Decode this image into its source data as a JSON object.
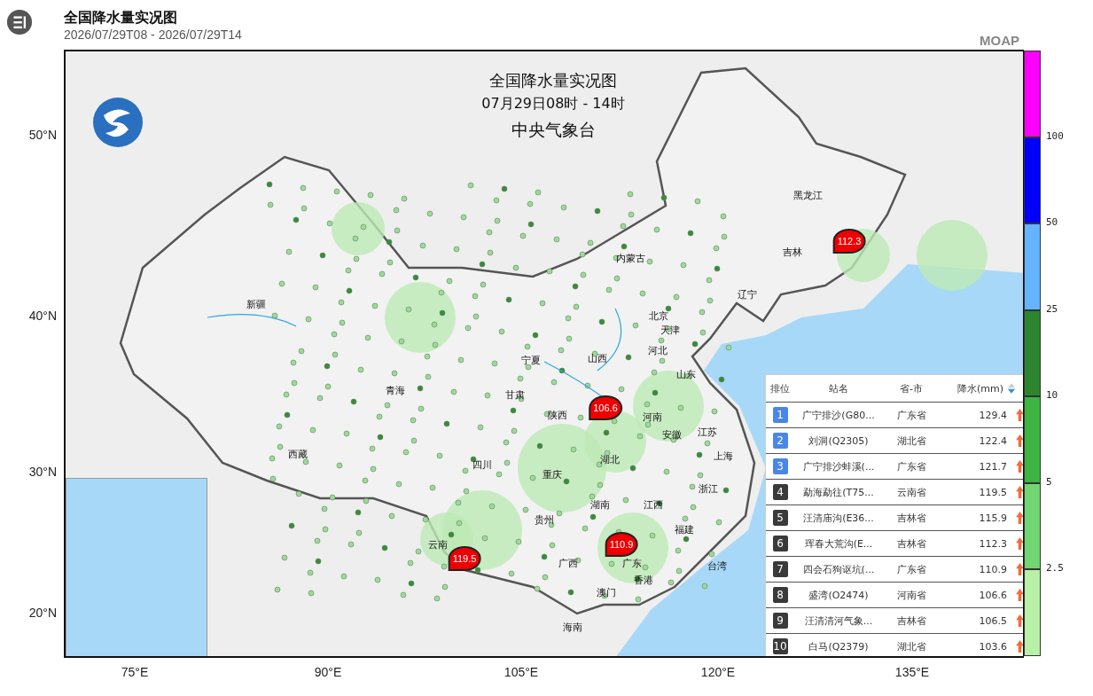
{
  "header": {
    "title": "全国降水量实况图",
    "time_range": "2026/07/29T08  -  2026/07/29T14",
    "product": "MOAP"
  },
  "map": {
    "title_lines": [
      "全国降水量实况图",
      "07月29日08时 - 14时",
      "中央气象台"
    ],
    "lat_ticks": [
      "50°N",
      "40°N",
      "30°N",
      "20°N"
    ],
    "lon_ticks": [
      "75°E",
      "90°E",
      "105°E",
      "120°E",
      "135°E"
    ],
    "region_labels": [
      "新疆",
      "西藏",
      "青海",
      "甘肃",
      "宁夏",
      "内蒙古",
      "黑龙江",
      "吉林",
      "辽宁",
      "北京",
      "天津",
      "河北",
      "山西",
      "山东",
      "河南",
      "陕西",
      "四川",
      "重庆",
      "湖北",
      "安徽",
      "江苏",
      "上海",
      "浙江",
      "湖南",
      "江西",
      "贵州",
      "云南",
      "广西",
      "广东",
      "福建",
      "台湾",
      "香港",
      "澳门",
      "海南"
    ],
    "markers": [
      "119.5",
      "106.6",
      "110.9",
      "112.3"
    ]
  },
  "legend": [
    {
      "color": "#ff00ff"
    },
    {
      "color": "#0000ff",
      "label": "100"
    },
    {
      "color": "#66b3ff",
      "label": "50"
    },
    {
      "color": "#2e8530",
      "label": "25"
    },
    {
      "color": "#3db540",
      "label": "10"
    },
    {
      "color": "#72d672",
      "label": "5"
    },
    {
      "color": "#b8f0a8",
      "label": "2.5"
    }
  ],
  "ranking": {
    "columns": [
      "排位",
      "站名",
      "省-市",
      "降水(mm)"
    ],
    "rows": [
      {
        "rank": "1",
        "color": "#4a86e8",
        "station": "广宁排沙(G80...",
        "province": "广东省",
        "value": "129.4"
      },
      {
        "rank": "2",
        "color": "#4a86e8",
        "station": "刘洞(Q2305)",
        "province": "湖北省",
        "value": "122.4"
      },
      {
        "rank": "3",
        "color": "#4a86e8",
        "station": "广宁排沙蚌溪(...",
        "province": "广东省",
        "value": "121.7"
      },
      {
        "rank": "4",
        "color": "#3a3a3a",
        "station": "勐海勐往(T75...",
        "province": "云南省",
        "value": "119.5"
      },
      {
        "rank": "5",
        "color": "#3a3a3a",
        "station": "汪清庙沟(E36...",
        "province": "吉林省",
        "value": "115.9"
      },
      {
        "rank": "6",
        "color": "#3a3a3a",
        "station": "珲春大荒沟(E...",
        "province": "吉林省",
        "value": "112.3"
      },
      {
        "rank": "7",
        "color": "#3a3a3a",
        "station": "四会石狗讴坑(...",
        "province": "广东省",
        "value": "110.9"
      },
      {
        "rank": "8",
        "color": "#3a3a3a",
        "station": "盛湾(O2474)",
        "province": "河南省",
        "value": "106.6"
      },
      {
        "rank": "9",
        "color": "#3a3a3a",
        "station": "汪清清河气象...",
        "province": "吉林省",
        "value": "106.5"
      },
      {
        "rank": "10",
        "color": "#3a3a3a",
        "station": "白马(Q2379)",
        "province": "湖北省",
        "value": "103.6"
      }
    ]
  }
}
